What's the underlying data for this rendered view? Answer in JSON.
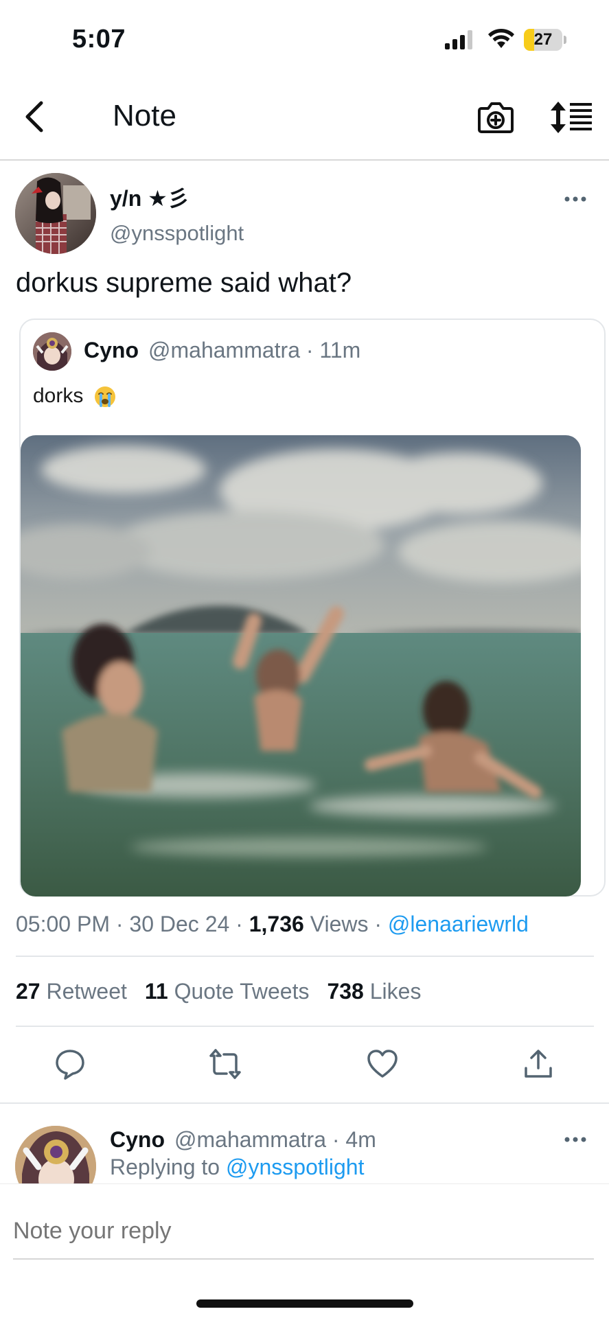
{
  "status_bar": {
    "time": "5:07",
    "battery_level": "27",
    "battery_fraction": 0.27
  },
  "nav": {
    "title": "Note",
    "back_icon": "chevron-left-icon",
    "camera_icon": "camera-plus-icon",
    "sort_icon": "sort-list-icon"
  },
  "tweet": {
    "author_name": "y/n ★彡",
    "author_handle": "@ynsspotlight",
    "text": "dorkus supreme said what?",
    "quoted": {
      "name": "Cyno",
      "meta": "@mahammatra · 11m",
      "text": "dorks",
      "emoji": "loudly-crying-face-icon"
    },
    "meta": {
      "time_date": "05:00 PM · 30 Dec 24 · ",
      "views_count": "1,736",
      "views_label": " Views · ",
      "via": "@lenaariewrld"
    },
    "stats": {
      "retweets": "27",
      "retweets_label": "Retweet",
      "quotes": "11",
      "quotes_label": "Quote Tweets",
      "likes": "738",
      "likes_label": "Likes"
    },
    "actions": [
      "reply-icon",
      "retweet-icon",
      "heart-icon",
      "share-icon"
    ]
  },
  "reply": {
    "name": "Cyno",
    "meta": "@mahammatra · 4m",
    "replying_label": "Replying to ",
    "replying_handle": "@ynsspotlight"
  },
  "composer": {
    "placeholder": "Note your reply"
  },
  "colors": {
    "accent": "#1d9bf0",
    "muted": "#6a7682",
    "text": "#0f1419",
    "battery": "#f7cc1a"
  }
}
